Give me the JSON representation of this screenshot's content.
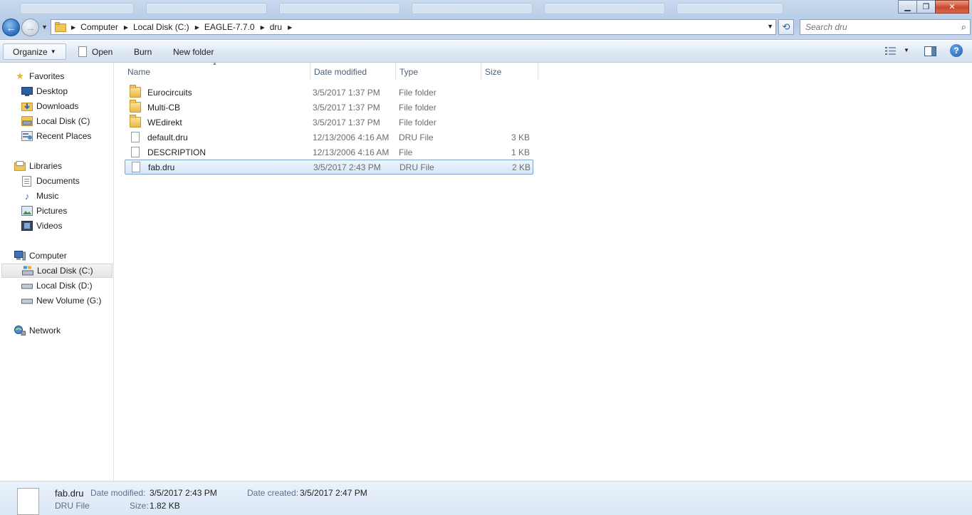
{
  "address": {
    "crumbs": [
      "Computer",
      "Local Disk (C:)",
      "EAGLE-7.7.0",
      "dru"
    ]
  },
  "search": {
    "placeholder": "Search dru"
  },
  "toolbar": {
    "organize": "Organize",
    "open": "Open",
    "burn": "Burn",
    "new_folder": "New folder"
  },
  "nav": {
    "favorites": "Favorites",
    "desktop": "Desktop",
    "downloads": "Downloads",
    "local_disk_c_fav": "Local Disk (C)",
    "recent_places": "Recent Places",
    "libraries": "Libraries",
    "documents": "Documents",
    "music": "Music",
    "pictures": "Pictures",
    "videos": "Videos",
    "computer": "Computer",
    "local_disk_c": "Local Disk (C:)",
    "local_disk_d": "Local Disk (D:)",
    "new_volume_g": "New Volume (G:)",
    "network": "Network"
  },
  "columns": {
    "name": "Name",
    "date": "Date modified",
    "type": "Type",
    "size": "Size"
  },
  "files": [
    {
      "name": "Eurocircuits",
      "date": "3/5/2017 1:37 PM",
      "type": "File folder",
      "size": "",
      "kind": "folder"
    },
    {
      "name": "Multi-CB",
      "date": "3/5/2017 1:37 PM",
      "type": "File folder",
      "size": "",
      "kind": "folder"
    },
    {
      "name": "WEdirekt",
      "date": "3/5/2017 1:37 PM",
      "type": "File folder",
      "size": "",
      "kind": "folder"
    },
    {
      "name": "default.dru",
      "date": "12/13/2006 4:16 AM",
      "type": "DRU File",
      "size": "3 KB",
      "kind": "file"
    },
    {
      "name": "DESCRIPTION",
      "date": "12/13/2006 4:16 AM",
      "type": "File",
      "size": "1 KB",
      "kind": "file"
    },
    {
      "name": "fab.dru",
      "date": "3/5/2017 2:43 PM",
      "type": "DRU File",
      "size": "2 KB",
      "kind": "file"
    }
  ],
  "details": {
    "filename": "fab.dru",
    "filetype": "DRU File",
    "date_modified_label": "Date modified:",
    "date_modified": "3/5/2017 2:43 PM",
    "date_created_label": "Date created:",
    "date_created": "3/5/2017 2:47 PM",
    "size_label": "Size:",
    "size": "1.82 KB"
  }
}
